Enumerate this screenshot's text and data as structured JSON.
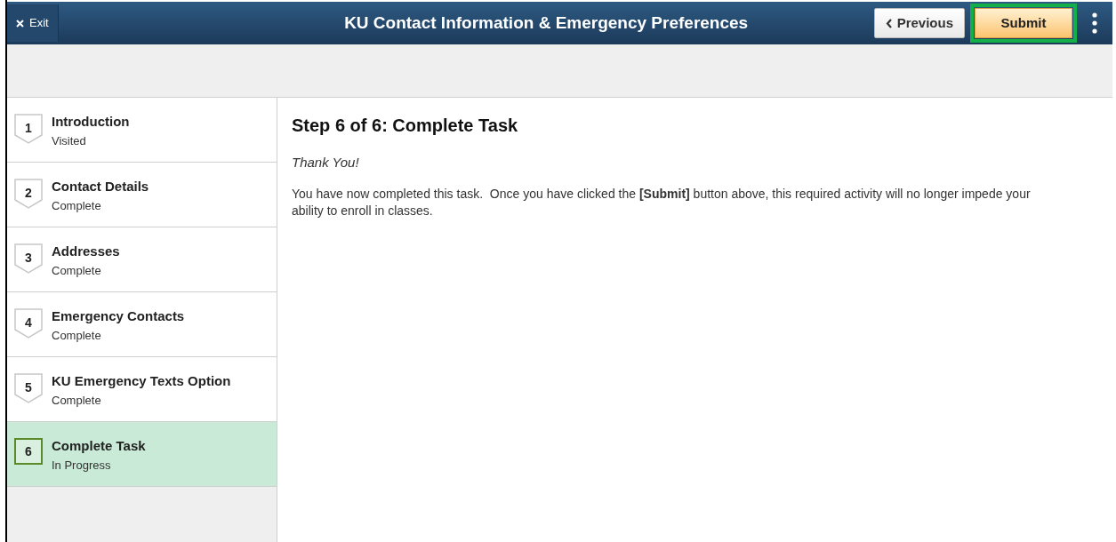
{
  "header": {
    "exit_label": "Exit",
    "title": "KU Contact Information & Emergency Preferences",
    "previous_label": "Previous",
    "submit_label": "Submit",
    "submit_highlighted": true
  },
  "steps": [
    {
      "number": "1",
      "title": "Introduction",
      "status": "Visited",
      "selected": false
    },
    {
      "number": "2",
      "title": "Contact Details",
      "status": "Complete",
      "selected": false
    },
    {
      "number": "3",
      "title": "Addresses",
      "status": "Complete",
      "selected": false
    },
    {
      "number": "4",
      "title": "Emergency Contacts",
      "status": "Complete",
      "selected": false
    },
    {
      "number": "5",
      "title": "KU Emergency Texts Option",
      "status": "Complete",
      "selected": false
    },
    {
      "number": "6",
      "title": "Complete Task",
      "status": "In Progress",
      "selected": true
    }
  ],
  "content": {
    "heading": "Step 6 of 6: Complete Task",
    "subheading": "Thank You!",
    "body": "You have now completed this task.  Once you have clicked the **[Submit]** button above, this required activity will no longer impede your ability to enroll in classes."
  }
}
